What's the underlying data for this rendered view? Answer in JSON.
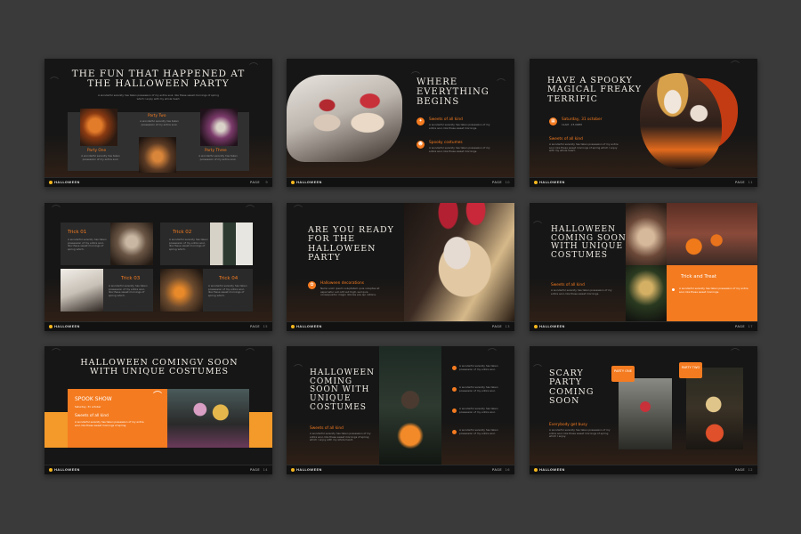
{
  "footer": {
    "brand": "HALLOWEEN",
    "page_label": "PAGE"
  },
  "slides": {
    "s1": {
      "title": "The fun that happened at the Halloween party",
      "subtitle": "A wonderful serenity has taken possession of my entire soul, like these sweet mornings of spring which I enjoy with my whole heart.",
      "party_two": "Party Two",
      "party_one": "Party One",
      "party_three": "Party Three",
      "desc": "A wonderful serenity has taken possession of my entire soul.",
      "page_num": "9"
    },
    "s2": {
      "title": "Where everything begins",
      "item1": "Sweets of all kind",
      "item2": "Spooky costumes",
      "desc": "A wonderful serenity has taken possession of my entire soul, like these sweet mornings.",
      "page_num": "10"
    },
    "s3": {
      "title": "Have a spooky magical freaky terrific",
      "date": "Saturday, 31 october",
      "time": "11AM - 23.00PM",
      "sweets": "Sweets of all kind",
      "desc": "A wonderful serenity has taken possession of my entire soul, like these sweet mornings of spring which I enjoy with my whole heart.",
      "page_num": "11"
    },
    "s4": {
      "t1": "Trick 01",
      "t2": "Trick 02",
      "t3": "Trick 03",
      "t4": "Trick 04",
      "desc": "A wonderful serenity has taken possession of my entire soul, like these sweet mornings of spring which.",
      "page_num": "15"
    },
    "s5": {
      "title": "Are you ready for the Halloween party",
      "item": "Halloween decorations",
      "desc": "Nemo enim ipsam voluptatem quia voluptas sit aspernatur aut odit aut fugit, sed quia consequuntur magni dolores eos qui ratione.",
      "page_num": "13"
    },
    "s6": {
      "title": "Halloween coming soon with unique costumes",
      "sweets": "Sweets of all kind",
      "trick": "Trick and Treat",
      "desc": "A wonderful serenity has taken possession of my entire soul, like these sweet mornings.",
      "page_num": "17"
    },
    "s7": {
      "title": "Halloween comingv soon with unique costumes",
      "spook": "SPOOK SHOW",
      "date": "Saturday, 31 october",
      "sweets": "Sweets of all kind",
      "desc": "A wonderful serenity has taken possession of my entire soul, like these sweet mornings of spring.",
      "page_num": "14"
    },
    "s8": {
      "title": "Halloween coming soon with unique costumes",
      "sweets": "Sweets of all kind",
      "desc": "A wonderful serenity has taken possession of my entire soul, like these sweet mornings of spring which I enjoy with my whole heart.",
      "bullet": "A wonderful serenity has taken possession of my entire soul.",
      "page_num": "16"
    },
    "s9": {
      "title": "Scary party coming soon",
      "party_one": "PARTY ONE",
      "party_two": "PARTY TWO",
      "sub": "Everybody get busy",
      "desc": "A wonderful serenity has taken possession of my entire soul, like these sweet mornings of spring which I enjoy.",
      "page_num": "12"
    }
  },
  "colors": {
    "accent": "#f47b20",
    "background": "#3a3a3a",
    "slide": "#161616",
    "brand_dot": "#f5b71e"
  }
}
